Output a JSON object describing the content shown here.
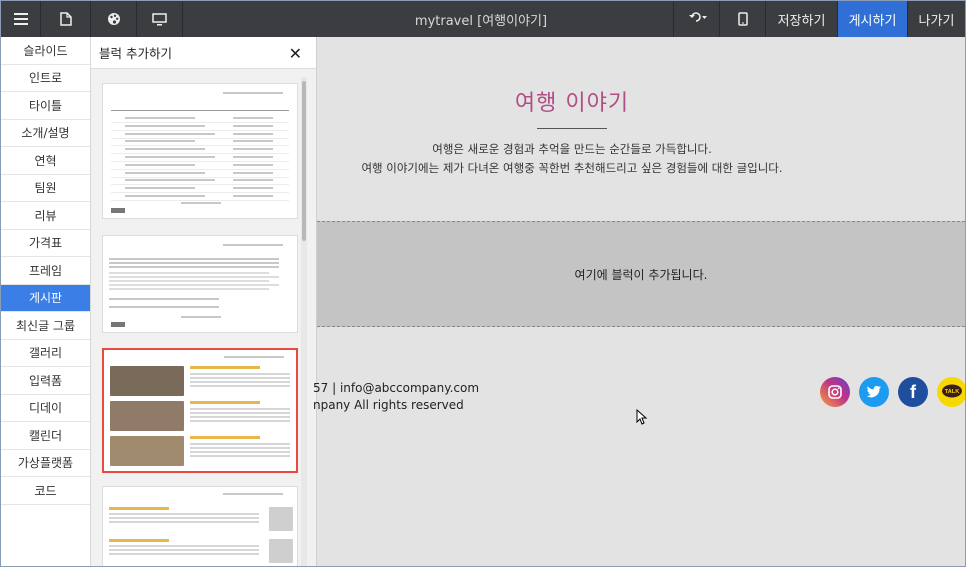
{
  "topbar": {
    "menu_icon": "hamburger-icon",
    "page_icon": "document-icon",
    "palette_icon": "palette-icon",
    "preview_icon": "monitor-icon",
    "title": "mytravel [여행이야기]",
    "undo_icon": "undo-icon",
    "mobile_icon": "mobile-icon",
    "save_label": "저장하기",
    "publish_label": "게시하기",
    "exit_label": "나가기",
    "publish_color": "#2f6fd6"
  },
  "categories": [
    {
      "label": "슬라이드"
    },
    {
      "label": "인트로"
    },
    {
      "label": "타이틀"
    },
    {
      "label": "소개/설명"
    },
    {
      "label": "연혁"
    },
    {
      "label": "팀원"
    },
    {
      "label": "리뷰"
    },
    {
      "label": "가격표"
    },
    {
      "label": "프레임"
    },
    {
      "label": "게시판",
      "active": true
    },
    {
      "label": "최신글 그룹"
    },
    {
      "label": "갤러리"
    },
    {
      "label": "입력폼"
    },
    {
      "label": "디데이"
    },
    {
      "label": "캘린더"
    },
    {
      "label": "가상플랫폼"
    },
    {
      "label": "코드"
    }
  ],
  "panel": {
    "title": "블럭 추가하기",
    "close_icon": "close-icon",
    "selected_border_color": "#e84a3c"
  },
  "canvas": {
    "section_title": "여행 이야기",
    "title_color": "#b04e86",
    "intro_line1": "여행은 새로운 경험과 추억을 만드는 순간들로 가득합니다.",
    "intro_line2": "여행 이야기에는 제가 다녀온 여행중 꼭한번 추천해드리고 싶은 경험들에 대한 글입니다.",
    "dropzone_text": "여기에 블럭이 추가됩니다.",
    "footer_line1": "57 | info@abccompany.com",
    "footer_line2": "npany All rights reserved",
    "social": [
      {
        "icon": "instagram-icon",
        "color": "#c13584",
        "glyph": "◎"
      },
      {
        "icon": "twitter-icon",
        "color": "#1d9bf0",
        "glyph": "✦"
      },
      {
        "icon": "facebook-icon",
        "color": "#1f4e9e",
        "glyph": "f"
      },
      {
        "icon": "kakaotalk-icon",
        "color": "#f7d800",
        "glyph": "TALK"
      }
    ]
  }
}
